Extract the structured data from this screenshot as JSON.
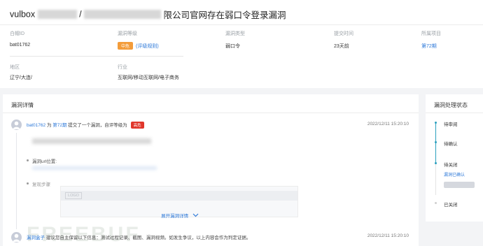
{
  "header": {
    "title_prefix": "vulbox",
    "title_suffix": "限公司官网存在弱口令登录漏洞"
  },
  "info": {
    "row1": [
      {
        "label": "白帽ID",
        "value": "bat01762"
      },
      {
        "label": "漏洞等级",
        "badge": "中危",
        "link": "(评级规则)"
      },
      {
        "label": "漏洞类型",
        "value": "弱口令"
      },
      {
        "label": "提交时间",
        "value": "23天前"
      },
      {
        "label": "所属项目",
        "value": "第72期"
      }
    ],
    "row2": [
      {
        "label": "地区",
        "value": "辽宁/大连/"
      },
      {
        "label": "行业",
        "value": "互联网/移动互联网/电子商务"
      }
    ]
  },
  "detail": {
    "panel_title": "漏洞详情",
    "entry1": {
      "user": "bat01762",
      "text1": "为",
      "project": "第72期",
      "text2": "提交了一个漏洞，自评等级为",
      "level": "高危",
      "date": "2022/12/11 15:20:10"
    },
    "url_label": "漏洞url位置:",
    "steps_label": "复现步骤",
    "logo_text": "LOGO",
    "expand_label": "展开漏洞详情",
    "expand_icon": "chevron-down-icon",
    "entry2": {
      "user": "漏洞盒子",
      "text": "建议您自主保留以下信息：测试过程记录、截图、漏洞视频。如发生争议，以上内容会作为判定证据。",
      "date": "2022/12/11 15:20:10"
    },
    "watermark": "FREEBUF"
  },
  "status": {
    "panel_title": "漏洞处理状态",
    "steps": [
      {
        "label": "待审阅"
      },
      {
        "label": "待确认"
      },
      {
        "label": "待关闭",
        "sub": "漏洞已确认"
      },
      {
        "label": "已关闭"
      }
    ]
  },
  "colors": {
    "link": "#2f7ad9",
    "medium": "#f39c3a",
    "high": "#e0362b",
    "timeline": "#2a9fbe"
  }
}
